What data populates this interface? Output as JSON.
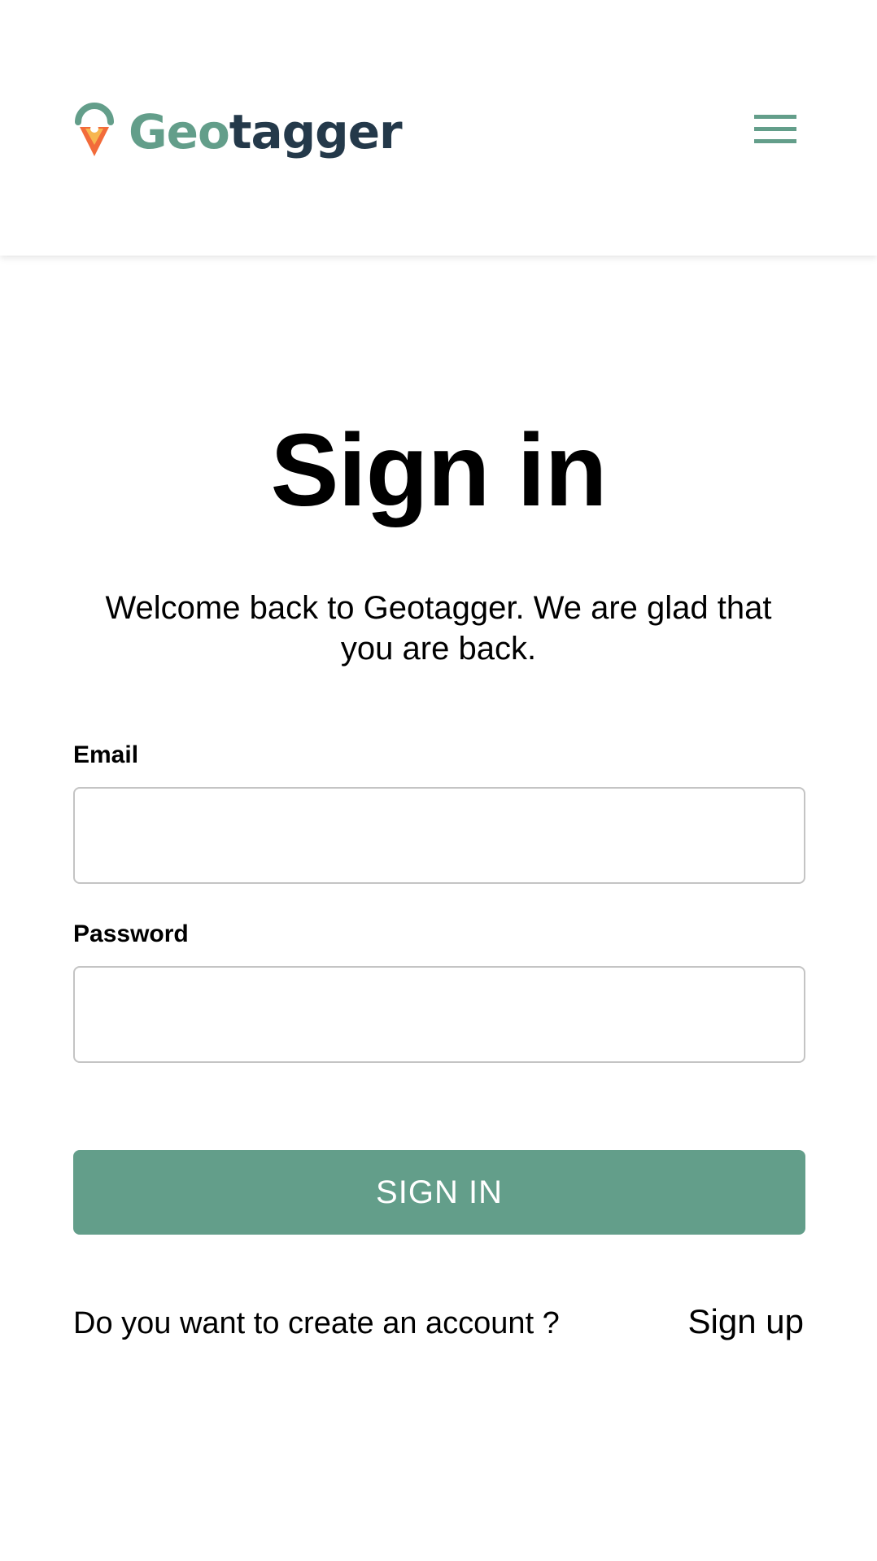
{
  "header": {
    "logo": {
      "text_part1": "Geo",
      "text_part2": "tagger",
      "icon": "map-pin-logo-icon"
    },
    "menu_icon": "hamburger-menu-icon"
  },
  "main": {
    "title": "Sign in",
    "subtitle": "Welcome back to Geotagger. We are glad that you are back.",
    "form": {
      "email_label": "Email",
      "email_value": "",
      "password_label": "Password",
      "password_value": "",
      "submit_label": "SIGN IN"
    },
    "footer": {
      "prompt": "Do you want to create an account ?",
      "signup_label": "Sign up"
    }
  },
  "colors": {
    "brand_green": "#639e8a",
    "brand_navy": "#24394a",
    "pin_orange": "#f26b3a",
    "pin_yellow": "#f7b64f",
    "input_border": "#c4c4c4"
  }
}
